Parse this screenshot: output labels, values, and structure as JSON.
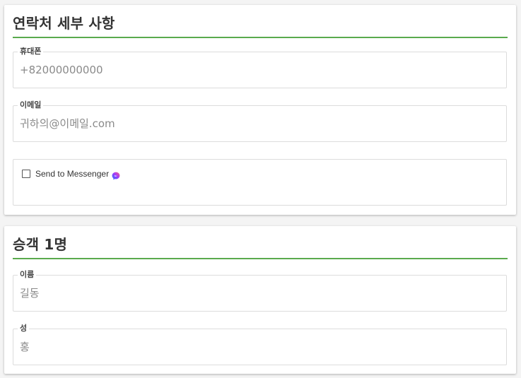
{
  "contact": {
    "title": "연락처 세부 사항",
    "phone": {
      "label": "휴대폰",
      "placeholder": "+82000000000",
      "value": ""
    },
    "email": {
      "label": "이메일",
      "placeholder": "귀하의@이메일.com",
      "value": ""
    },
    "messenger": {
      "label": "Send to Messenger",
      "checked": false,
      "icon": "messenger-icon"
    }
  },
  "passenger": {
    "title": "승객 1명",
    "first_name": {
      "label": "이름",
      "placeholder": "길동",
      "value": ""
    },
    "last_name": {
      "label": "성",
      "placeholder": "홍",
      "value": ""
    }
  },
  "colors": {
    "accent_underline": "#5aaa4d",
    "field_border": "#dcdcdc",
    "title_text": "#333333"
  }
}
